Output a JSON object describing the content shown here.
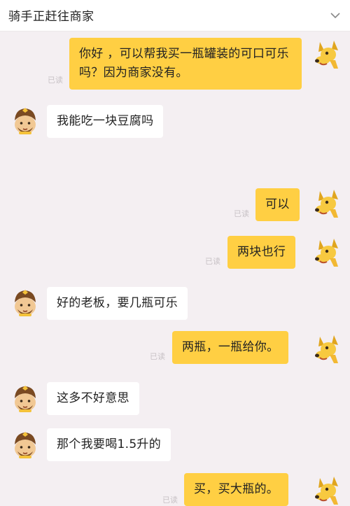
{
  "header": {
    "title": "骑手正赶往商家",
    "menu_icon": "chevron-down-icon"
  },
  "colors": {
    "outgoing_bubble": "#ffcf43",
    "incoming_bubble": "#ffffff",
    "background": "#f4eff2"
  },
  "messages": [
    {
      "side": "outgoing",
      "text": "你好 ，可以帮我买一瓶罐装的可口可乐吗？因为商家没有。",
      "status": "已读",
      "avatar": "dog-icon"
    },
    {
      "side": "incoming",
      "text": "我能吃一块豆腐吗",
      "avatar": "rider-icon"
    },
    {
      "side": "outgoing",
      "text": "可以",
      "status": "已读",
      "avatar": "dog-icon"
    },
    {
      "side": "outgoing",
      "text": "两块也行",
      "status": "已读",
      "avatar": "dog-icon"
    },
    {
      "side": "incoming",
      "text": "好的老板，要几瓶可乐",
      "avatar": "rider-icon"
    },
    {
      "side": "outgoing",
      "text": "两瓶，一瓶给你。",
      "status": "已读",
      "avatar": "dog-icon"
    },
    {
      "side": "incoming",
      "text": "这多不好意思",
      "avatar": "rider-icon"
    },
    {
      "side": "incoming",
      "text": "那个我要喝1.5升的",
      "avatar": "rider-icon"
    },
    {
      "side": "outgoing",
      "text": "买，买大瓶的。",
      "status": "已读",
      "avatar": "dog-icon"
    }
  ]
}
